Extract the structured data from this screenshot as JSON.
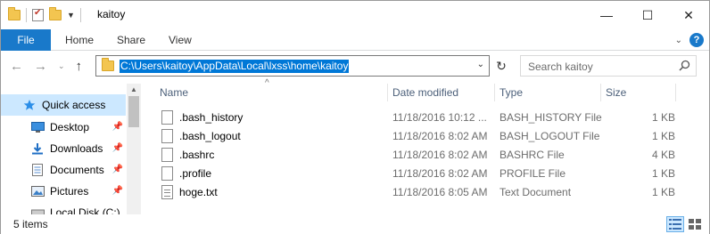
{
  "window": {
    "title": "kaitoy",
    "controls": {
      "minimize": "—",
      "maximize": "☐",
      "close": "✕"
    }
  },
  "ribbon": {
    "tabs": [
      "File",
      "Home",
      "Share",
      "View"
    ],
    "help": "?"
  },
  "nav": {
    "address": "C:\\Users\\kaitoy\\AppData\\Local\\lxss\\home\\kaitoy",
    "search_placeholder": "Search kaitoy"
  },
  "sidebar": {
    "items": [
      {
        "label": "Quick access",
        "icon": "star-icon",
        "selected": true
      },
      {
        "label": "Desktop",
        "icon": "desktop-icon",
        "pinned": true
      },
      {
        "label": "Downloads",
        "icon": "downloads-icon",
        "pinned": true
      },
      {
        "label": "Documents",
        "icon": "documents-icon",
        "pinned": true
      },
      {
        "label": "Pictures",
        "icon": "pictures-icon",
        "pinned": true
      },
      {
        "label": "Local Disk (C:)",
        "icon": "disk-icon"
      }
    ]
  },
  "columns": {
    "name": "Name",
    "date": "Date modified",
    "type": "Type",
    "size": "Size"
  },
  "files": [
    {
      "name": ".bash_history",
      "date": "11/18/2016 10:12 ...",
      "type": "BASH_HISTORY File",
      "size": "1 KB",
      "icon": "file-icon"
    },
    {
      "name": ".bash_logout",
      "date": "11/18/2016 8:02 AM",
      "type": "BASH_LOGOUT File",
      "size": "1 KB",
      "icon": "file-icon"
    },
    {
      "name": ".bashrc",
      "date": "11/18/2016 8:02 AM",
      "type": "BASHRC File",
      "size": "4 KB",
      "icon": "file-icon"
    },
    {
      "name": ".profile",
      "date": "11/18/2016 8:02 AM",
      "type": "PROFILE File",
      "size": "1 KB",
      "icon": "file-icon"
    },
    {
      "name": "hoge.txt",
      "date": "11/18/2016 8:05 AM",
      "type": "Text Document",
      "size": "1 KB",
      "icon": "text-file-icon"
    }
  ],
  "status": {
    "items_count": "5 items"
  },
  "colors": {
    "accent": "#1979ca",
    "selection": "#cce8ff",
    "address_highlight": "#0078d7"
  }
}
